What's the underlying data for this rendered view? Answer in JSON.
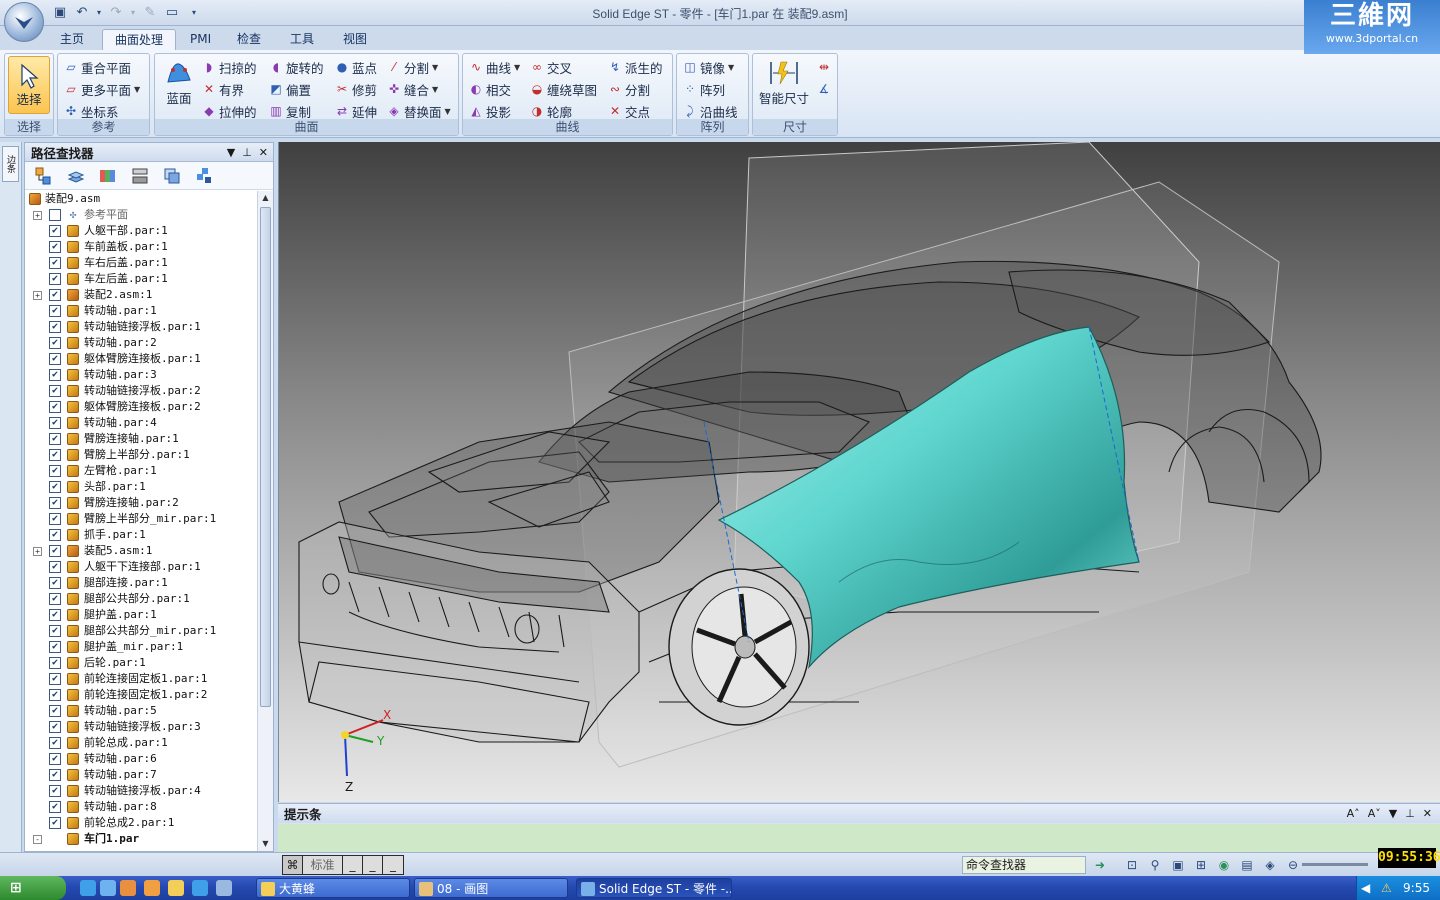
{
  "window": {
    "title": "Solid Edge ST - 零件 - [车门1.par 在 装配9.asm]",
    "logo_big": "三維网",
    "logo_small": "www.3dportal.cn"
  },
  "tabs": [
    "主页",
    "曲面处理",
    "PMI",
    "检查",
    "工具",
    "视图"
  ],
  "active_tab": "曲面处理",
  "ribbon": {
    "select": {
      "label": "选择",
      "group": "选择"
    },
    "reference": {
      "items": [
        "重合平面",
        "更多平面",
        "坐标系"
      ],
      "group": "参考"
    },
    "surface": {
      "bluesurf": "蓝面",
      "items": [
        "扫掠的",
        "有界",
        "拉伸的",
        "旋转的",
        "偏置",
        "复制",
        "蓝点",
        "修剪",
        "延伸",
        "分割",
        "缝合",
        "替换面"
      ],
      "group": "曲面"
    },
    "curves": {
      "items": [
        "曲线",
        "相交",
        "投影",
        "交叉",
        "缠绕草图",
        "轮廓",
        "派生的",
        "分割",
        "交点"
      ],
      "group": "曲线"
    },
    "pattern": {
      "items": [
        "镜像",
        "阵列",
        "沿曲线"
      ],
      "group": "阵列"
    },
    "dimension": {
      "label": "智能尺寸",
      "group": "尺寸"
    }
  },
  "side_tab": "边条",
  "pathfinder": {
    "title": "路径查找器",
    "tree": [
      {
        "label": "装配9.asm",
        "type": "root"
      },
      {
        "label": "参考平面",
        "type": "ref",
        "expand": "+",
        "checked": false
      },
      {
        "label": "人躯干部.par:1",
        "type": "part",
        "checked": true
      },
      {
        "label": "车前盖板.par:1",
        "type": "part",
        "checked": true
      },
      {
        "label": "车右后盖.par:1",
        "type": "part",
        "checked": true
      },
      {
        "label": "车左后盖.par:1",
        "type": "part",
        "checked": true
      },
      {
        "label": "装配2.asm:1",
        "type": "asm",
        "expand": "+",
        "checked": true
      },
      {
        "label": "转动轴.par:1",
        "type": "part",
        "checked": true
      },
      {
        "label": "转动轴链接浮板.par:1",
        "type": "part",
        "checked": true
      },
      {
        "label": "转动轴.par:2",
        "type": "part",
        "checked": true
      },
      {
        "label": "躯体臂膀连接板.par:1",
        "type": "part",
        "checked": true
      },
      {
        "label": "转动轴.par:3",
        "type": "part",
        "checked": true
      },
      {
        "label": "转动轴链接浮板.par:2",
        "type": "part",
        "checked": true
      },
      {
        "label": "躯体臂膀连接板.par:2",
        "type": "part",
        "checked": true
      },
      {
        "label": "转动轴.par:4",
        "type": "part",
        "checked": true
      },
      {
        "label": "臂膀连接轴.par:1",
        "type": "part",
        "checked": true
      },
      {
        "label": "臂膀上半部分.par:1",
        "type": "part",
        "checked": true
      },
      {
        "label": "左臂枪.par:1",
        "type": "part",
        "checked": true
      },
      {
        "label": "头部.par:1",
        "type": "part",
        "checked": true
      },
      {
        "label": "臂膀连接轴.par:2",
        "type": "part",
        "checked": true
      },
      {
        "label": "臂膀上半部分_mir.par:1",
        "type": "part",
        "checked": true
      },
      {
        "label": "抓手.par:1",
        "type": "part",
        "checked": true
      },
      {
        "label": "装配5.asm:1",
        "type": "asm",
        "expand": "+",
        "checked": true
      },
      {
        "label": "人躯干下连接部.par:1",
        "type": "part",
        "checked": true
      },
      {
        "label": "腿部连接.par:1",
        "type": "part",
        "checked": true
      },
      {
        "label": "腿部公共部分.par:1",
        "type": "part",
        "checked": true
      },
      {
        "label": "腿护盖.par:1",
        "type": "part",
        "checked": true
      },
      {
        "label": "腿部公共部分_mir.par:1",
        "type": "part",
        "checked": true
      },
      {
        "label": "腿护盖_mir.par:1",
        "type": "part",
        "checked": true
      },
      {
        "label": "后轮.par:1",
        "type": "part",
        "checked": true
      },
      {
        "label": "前轮连接固定板1.par:1",
        "type": "part",
        "checked": true
      },
      {
        "label": "前轮连接固定板1.par:2",
        "type": "part",
        "checked": true
      },
      {
        "label": "转动轴.par:5",
        "type": "part",
        "checked": true
      },
      {
        "label": "转动轴链接浮板.par:3",
        "type": "part",
        "checked": true
      },
      {
        "label": "前轮总成.par:1",
        "type": "part",
        "checked": true
      },
      {
        "label": "转动轴.par:6",
        "type": "part",
        "checked": true
      },
      {
        "label": "转动轴.par:7",
        "type": "part",
        "checked": true
      },
      {
        "label": "转动轴链接浮板.par:4",
        "type": "part",
        "checked": true
      },
      {
        "label": "转动轴.par:8",
        "type": "part",
        "checked": true
      },
      {
        "label": "前轮总成2.par:1",
        "type": "part",
        "checked": true
      },
      {
        "label": "车门1.par",
        "type": "part",
        "expand": "-",
        "bold": true
      }
    ]
  },
  "viewport": {
    "axis_x": "X",
    "axis_y": "Y",
    "axis_z": "Z",
    "surface_color": "#5fd6cf"
  },
  "prompt": {
    "title": "提示条"
  },
  "status": {
    "standard": "标准",
    "cmd_finder": "命令查找器"
  },
  "clock_overlay": "09:55:36",
  "taskbar": {
    "items": [
      "大黄蜂",
      "08 - 画图",
      "Solid Edge ST - 零件 -..."
    ],
    "time": "9:55"
  }
}
